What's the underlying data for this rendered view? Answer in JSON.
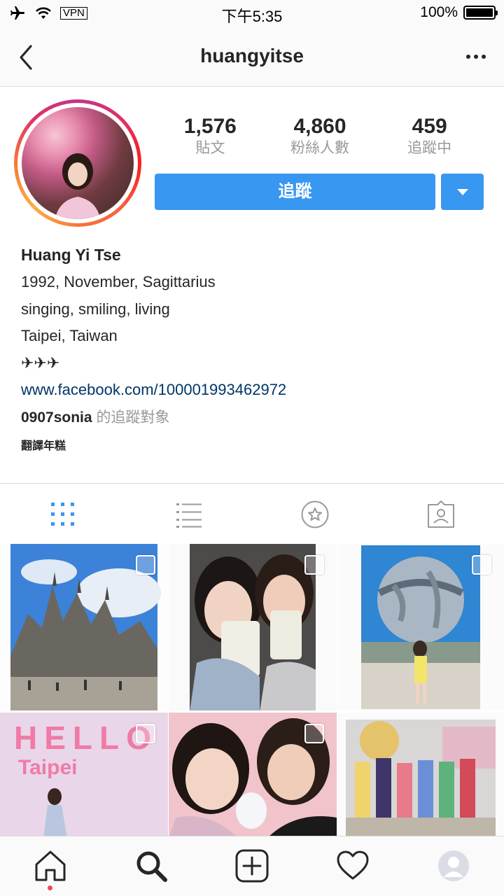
{
  "status_bar": {
    "vpn": "VPN",
    "time": "下午5:35",
    "battery": "100%"
  },
  "nav": {
    "title": "huangyitse"
  },
  "stats": [
    {
      "value": "1,576",
      "label": "貼文"
    },
    {
      "value": "4,860",
      "label": "粉絲人數"
    },
    {
      "value": "459",
      "label": "追蹤中"
    }
  ],
  "follow_button": "追蹤",
  "bio": {
    "name": "Huang Yi Tse",
    "lines": [
      "1992, November, Sagittarius",
      "singing, smiling, living",
      "Taipei, Taiwan",
      "✈✈✈"
    ],
    "link": "www.facebook.com/100001993462972",
    "followed_by_user": "0907sonia",
    "followed_by_suffix": " 的追蹤對象",
    "translate": "翻譯年糕"
  },
  "grid_posts": [
    {
      "text": ""
    },
    {
      "text": ""
    },
    {
      "text": ""
    },
    {
      "text": "HELLO"
    },
    {
      "text": ""
    },
    {
      "text": ""
    }
  ],
  "grid_caption_4": "Taipei",
  "colors": {
    "accent": "#3897f0",
    "link": "#003569",
    "badge_dot": "#ed4956"
  }
}
